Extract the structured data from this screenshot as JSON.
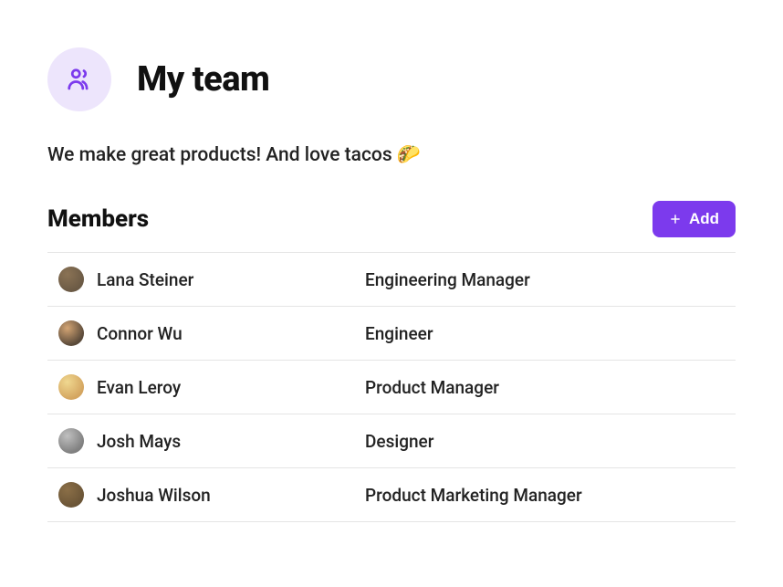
{
  "header": {
    "title": "My team",
    "icon": "people-icon"
  },
  "description": "We make great products! And love tacos 🌮",
  "members": {
    "title": "Members",
    "add_label": "Add",
    "items": [
      {
        "name": "Lana Steiner",
        "role": "Engineering Manager",
        "avatar_colors": [
          "#8b7355",
          "#6b5a45"
        ]
      },
      {
        "name": "Connor Wu",
        "role": "Engineer",
        "avatar_colors": [
          "#d4a574",
          "#5a4a3a"
        ]
      },
      {
        "name": "Evan Leroy",
        "role": "Product Manager",
        "avatar_colors": [
          "#f0d890",
          "#d4a560"
        ]
      },
      {
        "name": "Josh Mays",
        "role": "Designer",
        "avatar_colors": [
          "#c0c0c0",
          "#808080"
        ]
      },
      {
        "name": "Joshua Wilson",
        "role": "Product Marketing Manager",
        "avatar_colors": [
          "#8b6f47",
          "#6b5537"
        ]
      }
    ]
  }
}
